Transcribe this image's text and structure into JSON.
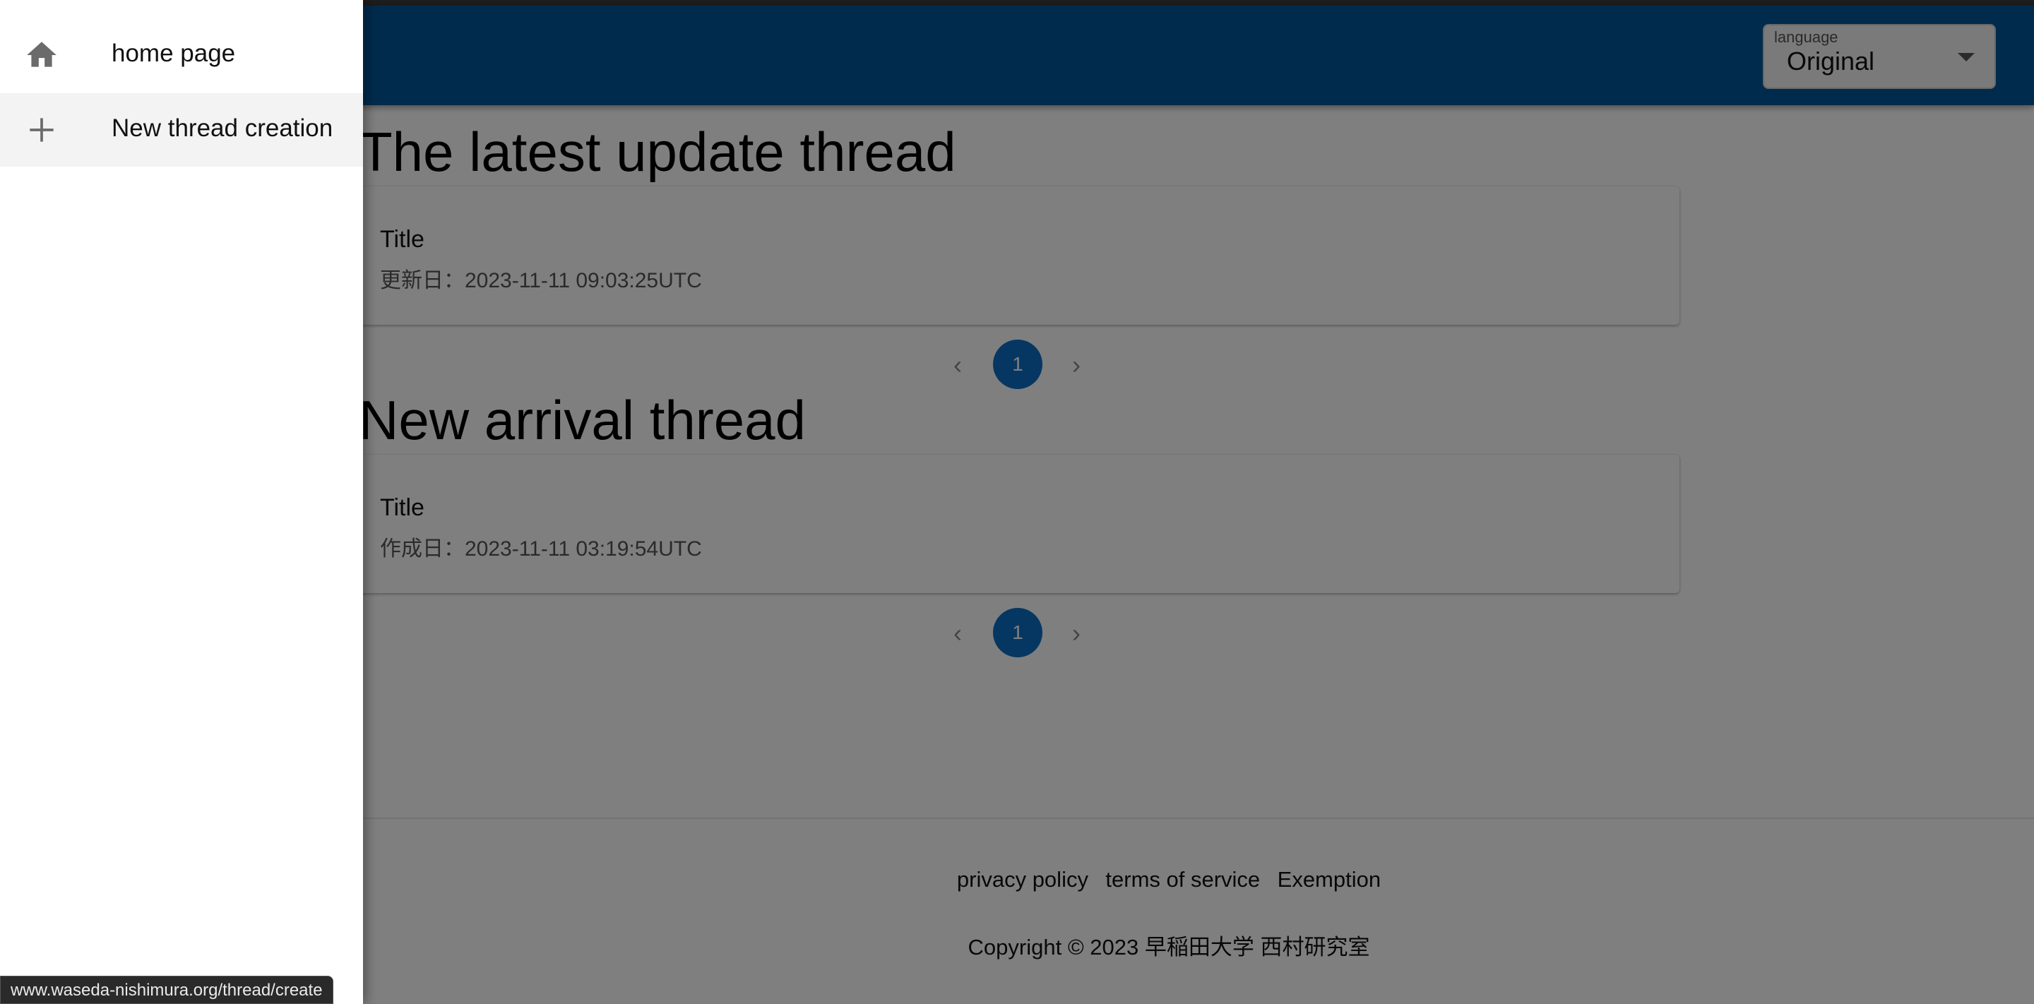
{
  "language": {
    "label": "language",
    "value": "Original"
  },
  "sections": [
    {
      "title": "The latest update thread",
      "card": {
        "title": "Title",
        "date": "更新日：2023-11-11 09:03:25UTC"
      },
      "page": "1"
    },
    {
      "title": "New arrival thread",
      "card": {
        "title": "Title",
        "date": "作成日：2023-11-11 03:19:54UTC"
      },
      "page": "1"
    }
  ],
  "footer": {
    "links": [
      "privacy policy",
      "terms of service",
      "Exemption"
    ],
    "copyright": "Copyright © 2023 早稲田大学 西村研究室"
  },
  "drawer": {
    "items": [
      {
        "label": "home page",
        "icon": "home-icon"
      },
      {
        "label": "New thread creation",
        "icon": "plus-icon"
      }
    ]
  },
  "status_bar": {
    "url": "www.waseda-nishimura.org/thread/create"
  },
  "colors": {
    "appbar": "#01579b",
    "page_active": "#0d6fc4"
  }
}
